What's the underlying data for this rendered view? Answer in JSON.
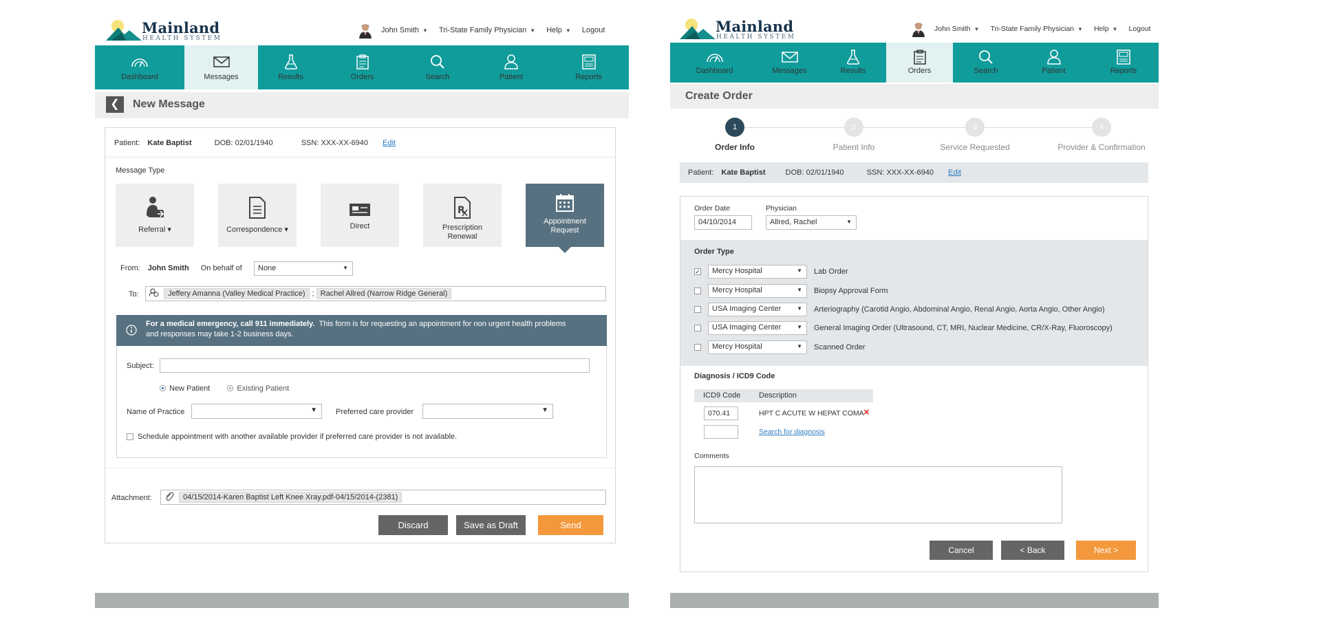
{
  "brand": {
    "name": "Mainland",
    "sub": "HEALTH SYSTEM"
  },
  "topbar": {
    "user": "John Smith",
    "role": "Tri-State Family Physician",
    "help": "Help",
    "logout": "Logout"
  },
  "nav": [
    {
      "label": "Dashboard",
      "icon": "gauge-icon"
    },
    {
      "label": "Messages",
      "icon": "envelope-icon"
    },
    {
      "label": "Results",
      "icon": "flask-icon"
    },
    {
      "label": "Orders",
      "icon": "clipboard-icon"
    },
    {
      "label": "Search",
      "icon": "search-icon"
    },
    {
      "label": "Patient",
      "icon": "person-icon"
    },
    {
      "label": "Reports",
      "icon": "report-icon"
    }
  ],
  "patient": {
    "label": "Patient:",
    "name": "Kate Baptist",
    "dob_label": "DOB:",
    "dob": "02/01/1940",
    "ssn_label": "SSN:",
    "ssn": "XXX-XX-6940",
    "edit": "Edit"
  },
  "message": {
    "title": "New Message",
    "type_label": "Message Type",
    "types": [
      {
        "label": "Referral ▾",
        "icon": "referral-icon"
      },
      {
        "label": "Correspondence ▾",
        "icon": "document-icon"
      },
      {
        "label": "Direct",
        "icon": "direct-card-icon"
      },
      {
        "label": "Prescription",
        "label2": "Renewal",
        "icon": "prescription-icon"
      },
      {
        "label": "Appointment",
        "label2": "Request",
        "icon": "calendar-icon"
      }
    ],
    "from_label": "From:",
    "from_name": "John Smith",
    "behalf_label": "On behalf of",
    "behalf_value": "None",
    "to_label": "To:",
    "recipients": [
      "Jeffery Amanna (Valley Medical Practice)",
      "Rachel Allred (Narrow Ridge General)"
    ],
    "recipient_sep": ";",
    "alert_bold": "For a medical emergency, call 911 immediately.",
    "alert_text": "This form is for requesting an appointment for non urgent health problems",
    "alert_text2": "and responses may take 1-2 business days.",
    "subject_label": "Subject:",
    "subject_value": "",
    "radio_new": "New Patient",
    "radio_existing": "Existing Patient",
    "practice_label": "Name of Practice",
    "practice_value": "",
    "provider_label": "Preferred care provider",
    "provider_value": "",
    "schedule_text": "Schedule appointment with another available provider if preferred care provider is not available.",
    "attachment_label": "Attachment:",
    "attachment_value": "04/15/2014-Karen Baptist Left Knee Xray.pdf-04/15/2014-(2381)",
    "discard": "Discard",
    "save_draft": "Save as Draft",
    "send": "Send"
  },
  "order": {
    "title": "Create Order",
    "steps": [
      {
        "num": "1",
        "label": "Order Info"
      },
      {
        "num": "2",
        "label": "Patient Info"
      },
      {
        "num": "3",
        "label": "Service Requested"
      },
      {
        "num": "4",
        "label": "Provider & Confirmation"
      }
    ],
    "date_label": "Order Date",
    "date_value": "04/10/2014",
    "physician_label": "Physician",
    "physician_value": "Allred, Rachel",
    "type_label": "Order Type",
    "types": [
      {
        "checked": "✓",
        "facility": "Mercy Hospital",
        "name": "Lab Order"
      },
      {
        "checked": "",
        "facility": "Mercy Hospital",
        "name": "Biopsy Approval Form"
      },
      {
        "checked": "",
        "facility": "USA Imaging Center",
        "name": "Arteriography (Carotid Angio, Abdominal Angio, Renal Angio, Aorta Angio, Other Angio)"
      },
      {
        "checked": "",
        "facility": "USA Imaging Center",
        "name": "General Imaging Order (Ultrasound, CT, MRI, Nuclear Medicine, CR/X-Ray, Fluoroscopy)"
      },
      {
        "checked": "",
        "facility": "Mercy Hospital",
        "name": "Scanned Order"
      }
    ],
    "diag_label": "Diagnosis / ICD9 Code",
    "col_code": "ICD9 Code",
    "col_desc": "Description",
    "diag_code": "070.41",
    "diag_desc": "HPT C ACUTE W HEPAT COMA",
    "remove": "×",
    "search_diag": "Search for diagnosis",
    "comments_label": "Comments",
    "comments_value": "",
    "cancel": "Cancel",
    "back": "< Back",
    "next": "Next >"
  },
  "colors": {
    "teal": "#109c9b",
    "slate": "#577180",
    "orange": "#f3983c",
    "dark_button": "#656565"
  }
}
